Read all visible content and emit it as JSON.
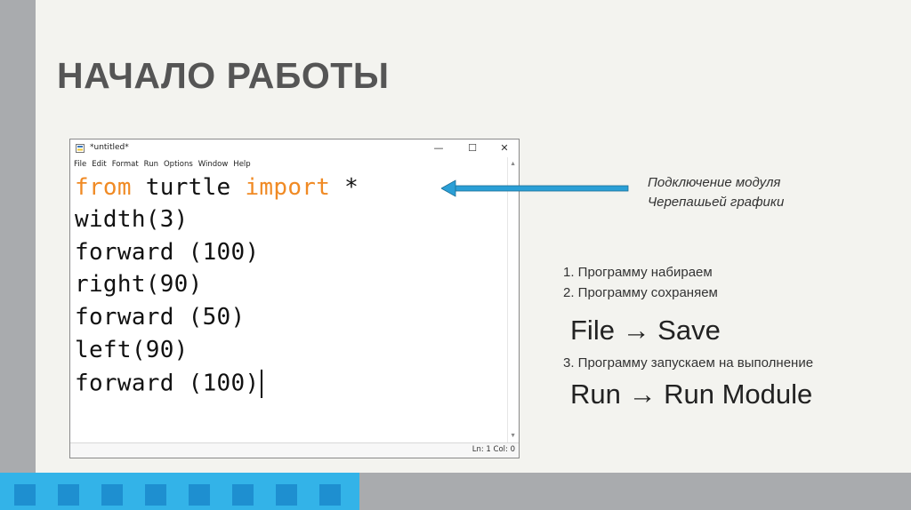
{
  "slide": {
    "title": "НАЧАЛО РАБОТЫ",
    "accent_color": "#33b3e8",
    "square_color": "#1e8fd0"
  },
  "idle": {
    "window_title": "*untitled*",
    "window_controls": {
      "minimize": "—",
      "maximize": "☐",
      "close": "✕"
    },
    "menu": [
      "File",
      "Edit",
      "Format",
      "Run",
      "Options",
      "Window",
      "Help"
    ],
    "code": {
      "line1": {
        "kw1": "from",
        "mid": " turtle ",
        "kw2": "import",
        "rest": " *"
      },
      "line2": "width(3)",
      "line3": "forward (100)",
      "line4": "right(90)",
      "line5": "forward (50)",
      "line6": "left(90)",
      "line7": "forward (100)"
    },
    "keyword_color": "#f08a24",
    "status": "Ln: 1   Col: 0"
  },
  "annotation": {
    "line1": "Подключение модуля",
    "line2": "Черепашьей графики",
    "arrow_color": "#2a9fd6"
  },
  "steps": {
    "step1": "1.  Программу набираем",
    "step2": "2.  Программу сохраняем",
    "save_cmd": "File → Save",
    "step3": "3. Программу запускаем на выполнение",
    "run_cmd": "Run → Run Module"
  }
}
